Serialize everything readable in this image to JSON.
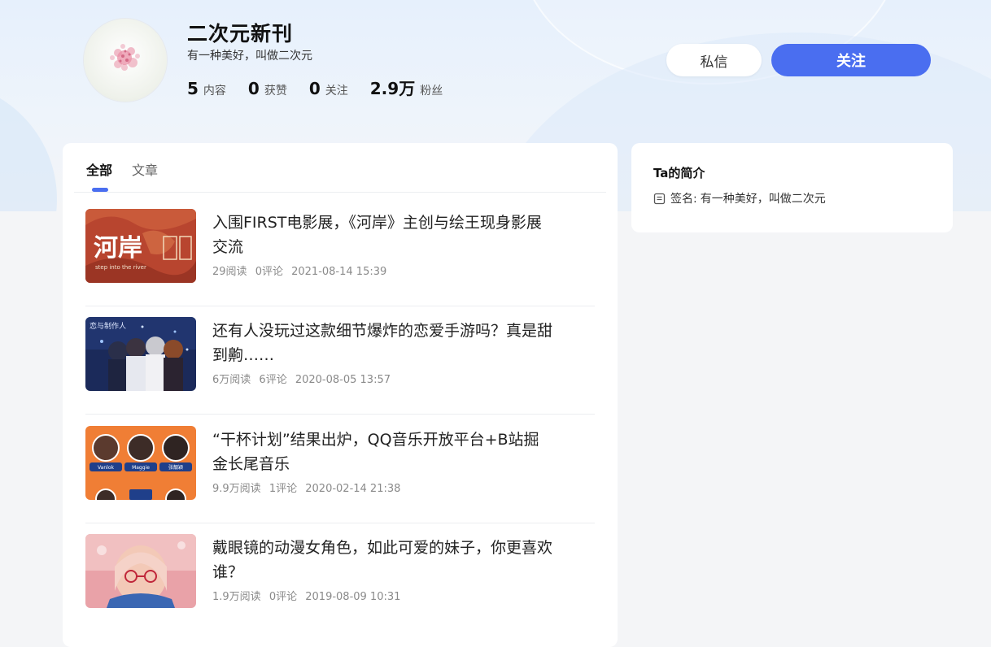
{
  "profile": {
    "name": "二次元新刊",
    "signature": "有一种美好，叫做二次元",
    "stats": [
      {
        "num": "5",
        "label": "内容"
      },
      {
        "num": "0",
        "label": "获赞"
      },
      {
        "num": "0",
        "label": "关注"
      },
      {
        "num": "2.9万",
        "label": "粉丝"
      }
    ]
  },
  "actions": {
    "message_label": "私信",
    "follow_label": "关注"
  },
  "tabs": [
    {
      "label": "全部"
    },
    {
      "label": "文章"
    }
  ],
  "articles": [
    {
      "title": "入围FIRST电影展，《河岸》主创与绘王现身影展交流",
      "reads": "29阅读",
      "comments": "0评论",
      "date": "2021-08-14 15:39"
    },
    {
      "title": "还有人没玩过这款细节爆炸的恋爱手游吗？真是甜到齁……",
      "reads": "6万阅读",
      "comments": "6评论",
      "date": "2020-08-05 13:57"
    },
    {
      "title": "“干杯计划”结果出炉，QQ音乐开放平台+B站掘金长尾音乐",
      "reads": "9.9万阅读",
      "comments": "1评论",
      "date": "2020-02-14 21:38"
    },
    {
      "title": "戴眼镜的动漫女角色，如此可爱的妹子，你更喜欢谁？",
      "reads": "1.9万阅读",
      "comments": "0评论",
      "date": "2019-08-09 10:31"
    }
  ],
  "thumb_texts": {
    "a0_main": "河岸",
    "a0_sub": "step into the river",
    "a1_logo": "恋与制作人",
    "a2_names": [
      "Vanlok",
      "Maggie",
      "张靓颖"
    ]
  },
  "sidebar": {
    "title": "Ta的简介",
    "signature_label": "签名:",
    "signature_value": "有一种美好，叫做二次元"
  },
  "colors": {
    "accent": "#4a6ef0",
    "page_bg": "#f4f5f7"
  }
}
